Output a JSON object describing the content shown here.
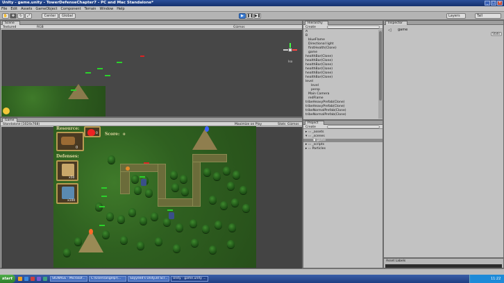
{
  "window": {
    "title": "Unity - game.unity - TowerDefenseChapter7 - PC and Mac Standalone*"
  },
  "menu": [
    "File",
    "Edit",
    "Assets",
    "GameObject",
    "Component",
    "Terrain",
    "Window",
    "Help"
  ],
  "toolbar": {
    "center_label": "Center",
    "local_label": "Global",
    "layers_label": "Layers",
    "layout_label": "Tall"
  },
  "scene": {
    "tab": "Scene",
    "textured": "Textured",
    "rgb": "RGB",
    "gizmos": "Gizmos",
    "persp_label": "Iso"
  },
  "game": {
    "tab": "Game",
    "resolution": "Standalone (1024x768)",
    "maximize_label": "Maximize on Play",
    "stats_label": "Stats",
    "gizmos_label": "Gizmos",
    "resource_label": "Resource:",
    "resource_value": "0",
    "score_label": "Score:",
    "score_value": "0",
    "defenses_label": "Defenses:",
    "defense1_cost": "x50",
    "defense2_cost": "x100",
    "lives_value": "0"
  },
  "hierarchy": {
    "tab": "Hierarchy",
    "create_label": "Create",
    "items": [
      "A",
      "B",
      "blueFlame",
      "Directional light",
      "firstHealth(Clone)",
      "game",
      "healthBar(Clone)",
      "healthBar(Clone)",
      "healthBar(Clone)",
      "healthBar(Clone)",
      "healthBar(Clone)",
      "healthBar(Clone)",
      "level",
      "level",
      "persp",
      "Main Camera",
      "redFlame",
      "tribeHeavyPrefab(Clone)",
      "tribeHeavyPrefab(Clone)",
      "tribeNormalPrefab(Clone)",
      "tribeNormalPrefab(Clone)"
    ]
  },
  "project": {
    "tab": "Project",
    "create_label": "Create",
    "items": [
      "_assets",
      "_scenes",
      "game",
      "_scripts",
      "Particles"
    ]
  },
  "inspector": {
    "tab": "Inspector",
    "object_name": "game",
    "static_label": "Static"
  },
  "asset_labels": {
    "title": "Asset Labels"
  },
  "taskbar": {
    "start_label": "start",
    "tasks": [
      "SIGNAGE - Microsof...",
      "C:\\Users\\angelpr\\...",
      "Sayyeed's Unity3d Scr...",
      "Unity - game.unity ..."
    ],
    "clock": "11:22"
  },
  "colors": {
    "accent": "#3a7ad0",
    "health": "#2bd22b"
  }
}
